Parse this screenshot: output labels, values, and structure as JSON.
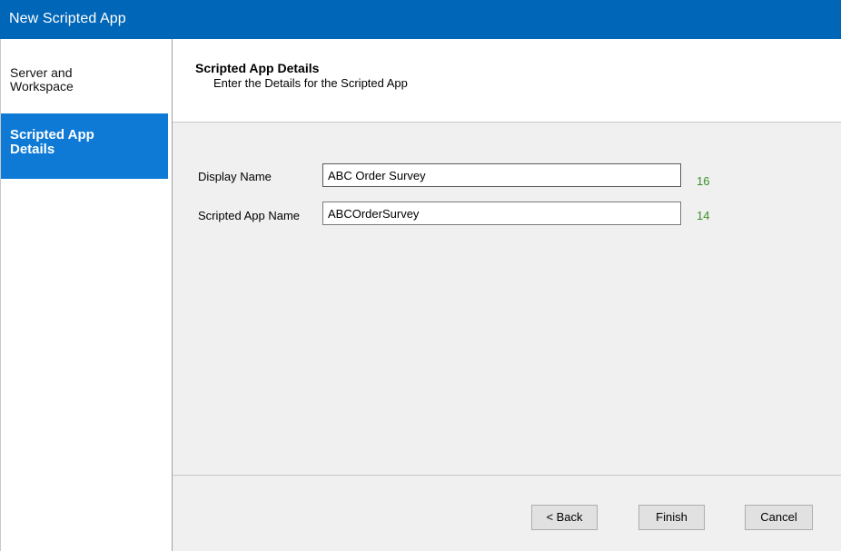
{
  "window": {
    "title": "New Scripted App"
  },
  "sidebar": {
    "items": [
      {
        "label": "Server and\nWorkspace",
        "selected": false
      },
      {
        "label": "Scripted App\nDetails",
        "selected": true
      }
    ],
    "selected_color": "#0e7ad6"
  },
  "header": {
    "title": "Scripted App Details",
    "subtitle": "Enter the Details for the Scripted App"
  },
  "form": {
    "display_name": {
      "label": "Display Name",
      "value": "ABC Order Survey",
      "count": "16"
    },
    "scripted_app_name": {
      "label": "Scripted App Name",
      "value": "ABCOrderSurvey",
      "count": "14"
    },
    "count_color": "#3a8f2a"
  },
  "footer": {
    "back_label": "< Back",
    "finish_label": "Finish",
    "cancel_label": "Cancel"
  },
  "colors": {
    "titlebar": "#0066b8",
    "panel_bg": "#f0f0f0"
  }
}
